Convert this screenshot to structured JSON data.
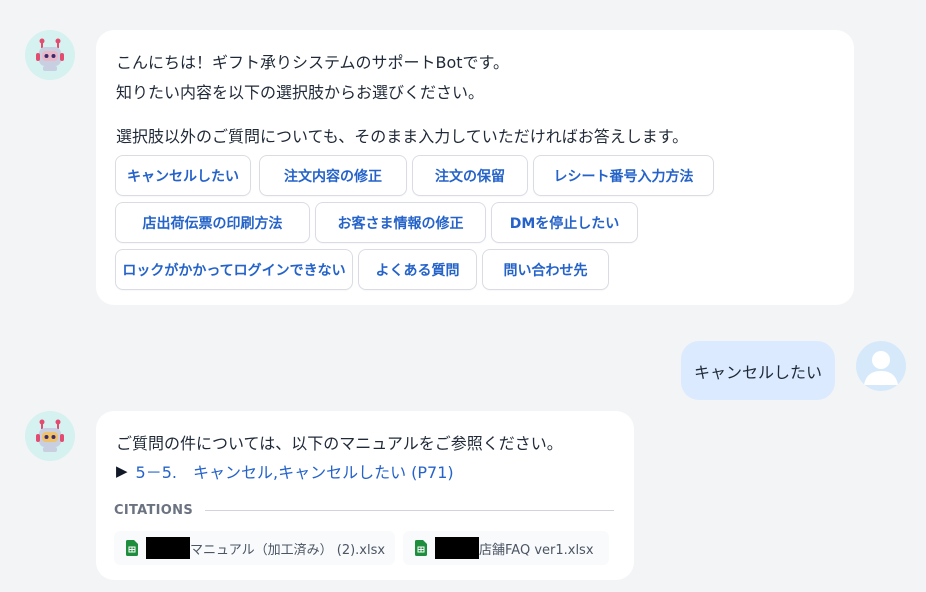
{
  "bot_message_1": {
    "lines": [
      "こんにちは！ギフト承りシステムのサポートBotです。",
      "知りたい内容を以下の選択肢からお選びください。",
      "選択肢以外のご質問についても、そのまま入力していただければお答えします。"
    ],
    "options": [
      "キャンセルしたい",
      "注文内容の修正",
      "注文の保留",
      "レシート番号入力方法",
      "店出荷伝票の印刷方法",
      "お客さま情報の修正",
      "DMを停止したい",
      "ロックがかかってログインできない",
      "よくある質問",
      "問い合わせ先"
    ]
  },
  "user_message": {
    "text": "キャンセルしたい"
  },
  "bot_message_2": {
    "intro": "ご質問の件については、以下のマニュアルをご参照ください。",
    "link_marker": "▶",
    "link_text": "5－5.　キャンセル,キャンセルしたい (P71)",
    "citations_label": "CITATIONS",
    "citations": [
      "マニュアル（加工済み） (2).xlsx",
      "店舗FAQ ver1.xlsx"
    ]
  },
  "icons": {
    "bot_avatar": "robot-icon",
    "user_avatar": "user-icon",
    "citation_file": "spreadsheet-icon"
  },
  "colors": {
    "background": "#f3f4f6",
    "bubble": "#ffffff",
    "user_bubble": "#dbeafe",
    "accent": "#2563c9",
    "sheet_green": "#1e8e3e"
  }
}
